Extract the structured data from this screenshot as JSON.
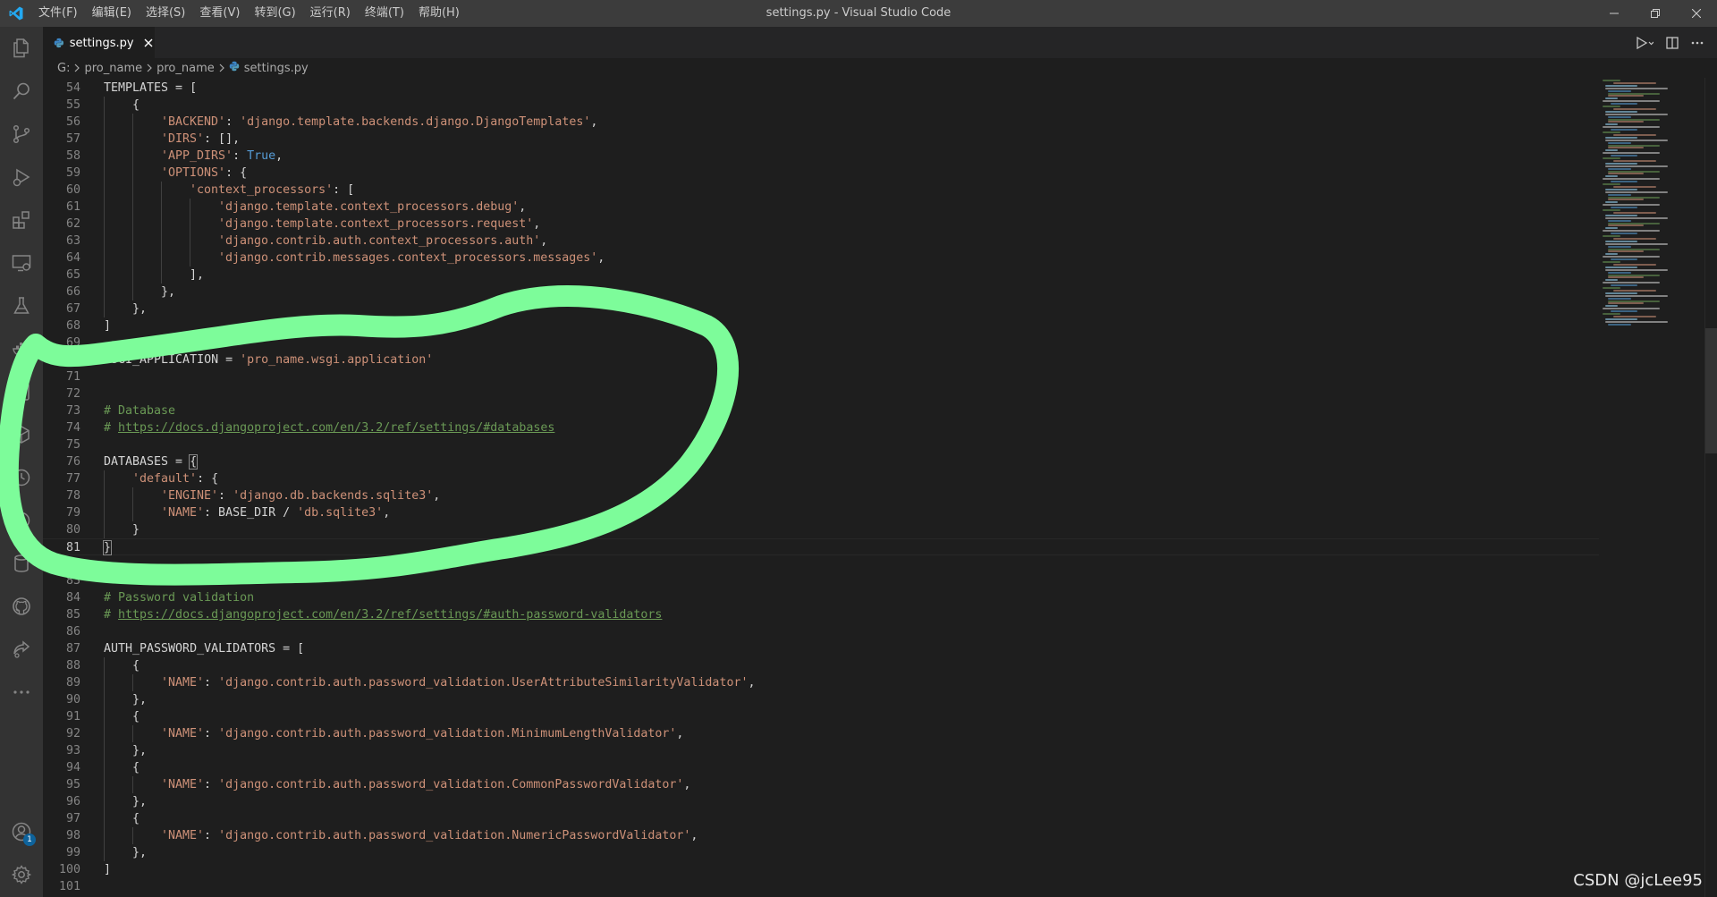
{
  "titlebar": {
    "menu": [
      "文件(F)",
      "编辑(E)",
      "选择(S)",
      "查看(V)",
      "转到(G)",
      "运行(R)",
      "终端(T)",
      "帮助(H)"
    ],
    "title": "settings.py - Visual Studio Code"
  },
  "activity_bar": {
    "icons": [
      "files-icon",
      "search-icon",
      "source-control-icon",
      "run-debug-icon",
      "extensions-icon",
      "remote-explorer-icon",
      "testing-icon",
      "docker-icon",
      "database-icon",
      "github-icon",
      "live-share-icon",
      "more-icon",
      "account-icon",
      "settings-gear-icon"
    ],
    "account_badge": "1"
  },
  "tabs": [
    {
      "label": "settings.py",
      "active": true
    }
  ],
  "breadcrumb": [
    "G:",
    "pro_name",
    "pro_name",
    "settings.py"
  ],
  "editor": {
    "active_line": 81,
    "lines": [
      {
        "n": 54,
        "indent": 0,
        "tokens": [
          [
            "v",
            "TEMPLATES = ["
          ]
        ]
      },
      {
        "n": 55,
        "indent": 1,
        "tokens": [
          [
            "v",
            "{"
          ]
        ]
      },
      {
        "n": 56,
        "indent": 2,
        "tokens": [
          [
            "s",
            "'BACKEND'"
          ],
          [
            "v",
            ": "
          ],
          [
            "s",
            "'django.template.backends.django.DjangoTemplates'"
          ],
          [
            "v",
            ","
          ]
        ]
      },
      {
        "n": 57,
        "indent": 2,
        "tokens": [
          [
            "s",
            "'DIRS'"
          ],
          [
            "v",
            ": [],"
          ]
        ]
      },
      {
        "n": 58,
        "indent": 2,
        "tokens": [
          [
            "s",
            "'APP_DIRS'"
          ],
          [
            "v",
            ": "
          ],
          [
            "k",
            "True"
          ],
          [
            "v",
            ","
          ]
        ]
      },
      {
        "n": 59,
        "indent": 2,
        "tokens": [
          [
            "s",
            "'OPTIONS'"
          ],
          [
            "v",
            ": {"
          ]
        ]
      },
      {
        "n": 60,
        "indent": 3,
        "tokens": [
          [
            "s",
            "'context_processors'"
          ],
          [
            "v",
            ": ["
          ]
        ]
      },
      {
        "n": 61,
        "indent": 4,
        "tokens": [
          [
            "s",
            "'django.template.context_processors.debug'"
          ],
          [
            "v",
            ","
          ]
        ]
      },
      {
        "n": 62,
        "indent": 4,
        "tokens": [
          [
            "s",
            "'django.template.context_processors.request'"
          ],
          [
            "v",
            ","
          ]
        ]
      },
      {
        "n": 63,
        "indent": 4,
        "tokens": [
          [
            "s",
            "'django.contrib.auth.context_processors.auth'"
          ],
          [
            "v",
            ","
          ]
        ]
      },
      {
        "n": 64,
        "indent": 4,
        "tokens": [
          [
            "s",
            "'django.contrib.messages.context_processors.messages'"
          ],
          [
            "v",
            ","
          ]
        ]
      },
      {
        "n": 65,
        "indent": 3,
        "tokens": [
          [
            "v",
            "],"
          ]
        ]
      },
      {
        "n": 66,
        "indent": 2,
        "tokens": [
          [
            "v",
            "},"
          ]
        ]
      },
      {
        "n": 67,
        "indent": 1,
        "tokens": [
          [
            "v",
            "},"
          ]
        ]
      },
      {
        "n": 68,
        "indent": 0,
        "tokens": [
          [
            "v",
            "]"
          ]
        ]
      },
      {
        "n": 69,
        "indent": 0,
        "tokens": []
      },
      {
        "n": 70,
        "indent": 0,
        "tokens": [
          [
            "v",
            "WSGI_APPLICATION = "
          ],
          [
            "s",
            "'pro_name.wsgi.application'"
          ]
        ]
      },
      {
        "n": 71,
        "indent": 0,
        "tokens": []
      },
      {
        "n": 72,
        "indent": 0,
        "tokens": []
      },
      {
        "n": 73,
        "indent": 0,
        "tokens": [
          [
            "c",
            "# Database"
          ]
        ]
      },
      {
        "n": 74,
        "indent": 0,
        "tokens": [
          [
            "c",
            "# "
          ],
          [
            "l",
            "https://docs.djangoproject.com/en/3.2/ref/settings/#databases"
          ]
        ]
      },
      {
        "n": 75,
        "indent": 0,
        "tokens": []
      },
      {
        "n": 76,
        "indent": 0,
        "tokens": [
          [
            "v",
            "DATABASES = "
          ],
          [
            "b",
            "{"
          ]
        ]
      },
      {
        "n": 77,
        "indent": 1,
        "tokens": [
          [
            "s",
            "'default'"
          ],
          [
            "v",
            ": {"
          ]
        ]
      },
      {
        "n": 78,
        "indent": 2,
        "tokens": [
          [
            "s",
            "'ENGINE'"
          ],
          [
            "v",
            ": "
          ],
          [
            "s",
            "'django.db.backends.sqlite3'"
          ],
          [
            "v",
            ","
          ]
        ]
      },
      {
        "n": 79,
        "indent": 2,
        "tokens": [
          [
            "s",
            "'NAME'"
          ],
          [
            "v",
            ": BASE_DIR / "
          ],
          [
            "s",
            "'db.sqlite3'"
          ],
          [
            "v",
            ","
          ]
        ]
      },
      {
        "n": 80,
        "indent": 1,
        "tokens": [
          [
            "v",
            "}"
          ]
        ]
      },
      {
        "n": 81,
        "indent": 0,
        "tokens": [
          [
            "b",
            "}"
          ]
        ]
      },
      {
        "n": 82,
        "indent": 0,
        "tokens": []
      },
      {
        "n": 83,
        "indent": 0,
        "tokens": []
      },
      {
        "n": 84,
        "indent": 0,
        "tokens": [
          [
            "c",
            "# Password validation"
          ]
        ]
      },
      {
        "n": 85,
        "indent": 0,
        "tokens": [
          [
            "c",
            "# "
          ],
          [
            "l",
            "https://docs.djangoproject.com/en/3.2/ref/settings/#auth-password-validators"
          ]
        ]
      },
      {
        "n": 86,
        "indent": 0,
        "tokens": []
      },
      {
        "n": 87,
        "indent": 0,
        "tokens": [
          [
            "v",
            "AUTH_PASSWORD_VALIDATORS = ["
          ]
        ]
      },
      {
        "n": 88,
        "indent": 1,
        "tokens": [
          [
            "v",
            "{"
          ]
        ]
      },
      {
        "n": 89,
        "indent": 2,
        "tokens": [
          [
            "s",
            "'NAME'"
          ],
          [
            "v",
            ": "
          ],
          [
            "s",
            "'django.contrib.auth.password_validation.UserAttributeSimilarityValidator'"
          ],
          [
            "v",
            ","
          ]
        ]
      },
      {
        "n": 90,
        "indent": 1,
        "tokens": [
          [
            "v",
            "},"
          ]
        ]
      },
      {
        "n": 91,
        "indent": 1,
        "tokens": [
          [
            "v",
            "{"
          ]
        ]
      },
      {
        "n": 92,
        "indent": 2,
        "tokens": [
          [
            "s",
            "'NAME'"
          ],
          [
            "v",
            ": "
          ],
          [
            "s",
            "'django.contrib.auth.password_validation.MinimumLengthValidator'"
          ],
          [
            "v",
            ","
          ]
        ]
      },
      {
        "n": 93,
        "indent": 1,
        "tokens": [
          [
            "v",
            "},"
          ]
        ]
      },
      {
        "n": 94,
        "indent": 1,
        "tokens": [
          [
            "v",
            "{"
          ]
        ]
      },
      {
        "n": 95,
        "indent": 2,
        "tokens": [
          [
            "s",
            "'NAME'"
          ],
          [
            "v",
            ": "
          ],
          [
            "s",
            "'django.contrib.auth.password_validation.CommonPasswordValidator'"
          ],
          [
            "v",
            ","
          ]
        ]
      },
      {
        "n": 96,
        "indent": 1,
        "tokens": [
          [
            "v",
            "},"
          ]
        ]
      },
      {
        "n": 97,
        "indent": 1,
        "tokens": [
          [
            "v",
            "{"
          ]
        ]
      },
      {
        "n": 98,
        "indent": 2,
        "tokens": [
          [
            "s",
            "'NAME'"
          ],
          [
            "v",
            ": "
          ],
          [
            "s",
            "'django.contrib.auth.password_validation.NumericPasswordValidator'"
          ],
          [
            "v",
            ","
          ]
        ]
      },
      {
        "n": 99,
        "indent": 1,
        "tokens": [
          [
            "v",
            "},"
          ]
        ]
      },
      {
        "n": 100,
        "indent": 0,
        "tokens": [
          [
            "v",
            "]"
          ]
        ]
      },
      {
        "n": 101,
        "indent": 0,
        "tokens": []
      }
    ]
  },
  "colors": {
    "accent": "#0e639c",
    "annotation": "#7dfc9a",
    "string": "#ce9178",
    "keyword": "#569cd6",
    "comment": "#6a9955"
  },
  "watermark": "CSDN @jcLee95"
}
